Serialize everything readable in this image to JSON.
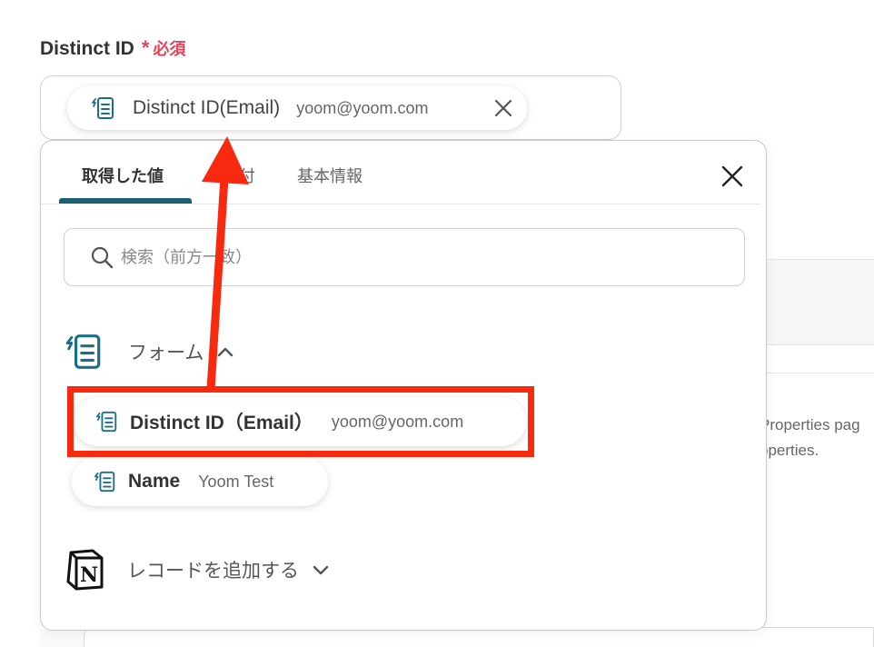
{
  "field": {
    "label": "Distinct ID",
    "required_star": "*",
    "required_text": "必須"
  },
  "selected_chip": {
    "label": "Distinct ID(Email)",
    "value": "yoom@yoom.com",
    "icon": "form-icon",
    "close_icon": "close-icon"
  },
  "background": {
    "text_line1": "Properties pag",
    "text_line2": "operties."
  },
  "dropdown": {
    "tabs": [
      {
        "label": "取得した値",
        "active": true
      },
      {
        "label": "日付",
        "active": false
      },
      {
        "label": "基本情報",
        "active": false
      }
    ],
    "search": {
      "placeholder": "検索（前方一致）",
      "icon": "search-icon"
    },
    "sections": [
      {
        "title": "フォーム",
        "icon": "form-icon",
        "expanded": true,
        "items": [
          {
            "label": "Distinct ID（Email）",
            "value": "yoom@yoom.com",
            "icon": "form-icon"
          },
          {
            "label": "Name",
            "value": "Yoom Test",
            "icon": "form-icon"
          }
        ]
      },
      {
        "title": "レコードを追加する",
        "icon": "notion-icon",
        "expanded": false,
        "items": []
      }
    ],
    "close_icon": "close-icon"
  },
  "annotation": {
    "highlight_color": "#f72a0f",
    "arrow_color": "#f72a0f"
  },
  "colors": {
    "accent": "#1a5f74",
    "required": "#e2455a"
  }
}
